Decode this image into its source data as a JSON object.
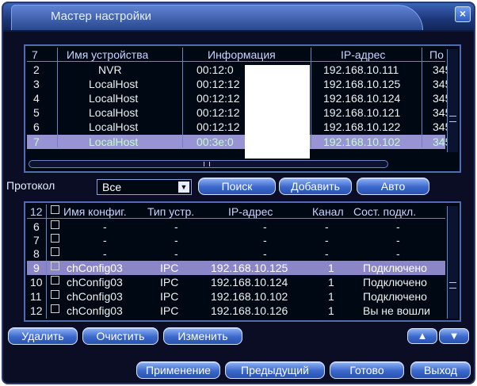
{
  "window": {
    "title": "Мастер настройки",
    "close_label": "×"
  },
  "devices": {
    "header": {
      "count": "7",
      "name": "Имя устройства",
      "info": "Информация",
      "ip": "IP-адрес",
      "port": "По"
    },
    "rows": [
      {
        "num": "2",
        "name": "NVR",
        "info": "00:12:0",
        "ip": "192.168.10.111",
        "port": "345"
      },
      {
        "num": "3",
        "name": "LocalHost",
        "info": "00:12:12",
        "ip": "192.168.10.125",
        "port": "345"
      },
      {
        "num": "4",
        "name": "LocalHost",
        "info": "00:12:12",
        "ip": "192.168.10.124",
        "port": "345"
      },
      {
        "num": "5",
        "name": "LocalHost",
        "info": "00:12:12",
        "ip": "192.168.10.121",
        "port": "345"
      },
      {
        "num": "6",
        "name": "LocalHost",
        "info": "00:12:12",
        "ip": "192.168.10.122",
        "port": "345"
      },
      {
        "num": "7",
        "name": "LocalHost",
        "info": "00:3e:0",
        "ip": "192.168.10.102",
        "port": "345"
      }
    ]
  },
  "search": {
    "protocol_label": "Протокол",
    "protocol_value": "Все",
    "search_button": "Поиск",
    "add_button": "Добавить",
    "auto_button": "Авто"
  },
  "configs": {
    "header": {
      "count": "12",
      "name": "Имя конфиг.",
      "type": "Тип устр.",
      "ip": "IP-адрес",
      "channel": "Канал",
      "status": "Сост. подкл."
    },
    "rows": [
      {
        "num": "6",
        "name": "-",
        "type": "-",
        "ip": "-",
        "channel": "-",
        "status": "-"
      },
      {
        "num": "7",
        "name": "-",
        "type": "-",
        "ip": "-",
        "channel": "-",
        "status": "-"
      },
      {
        "num": "8",
        "name": "-",
        "type": "-",
        "ip": "-",
        "channel": "-",
        "status": "-"
      },
      {
        "num": "9",
        "name": "chConfig03",
        "type": "IPC",
        "ip": "192.168.10.125",
        "channel": "1",
        "status": "Подключено"
      },
      {
        "num": "10",
        "name": "chConfig03",
        "type": "IPC",
        "ip": "192.168.10.124",
        "channel": "1",
        "status": "Подключено"
      },
      {
        "num": "11",
        "name": "chConfig03",
        "type": "IPC",
        "ip": "192.168.10.102",
        "channel": "1",
        "status": "Подключено"
      },
      {
        "num": "12",
        "name": "chConfig03",
        "type": "IPC",
        "ip": "192.168.10.126",
        "channel": "1",
        "status": "Вы не вошли"
      }
    ]
  },
  "config_actions": {
    "delete": "Удалить",
    "clear": "Очистить",
    "edit": "Изменить",
    "up": "▲",
    "down": "▼"
  },
  "footer": {
    "apply": "Применение",
    "prev": "Предыдущий",
    "done": "Готово",
    "exit": "Выход"
  },
  "colors": {
    "background": "#0a0d24",
    "title_bar": "#1c3778",
    "selected_row": "#9893d4",
    "button": "#3b68cc"
  }
}
